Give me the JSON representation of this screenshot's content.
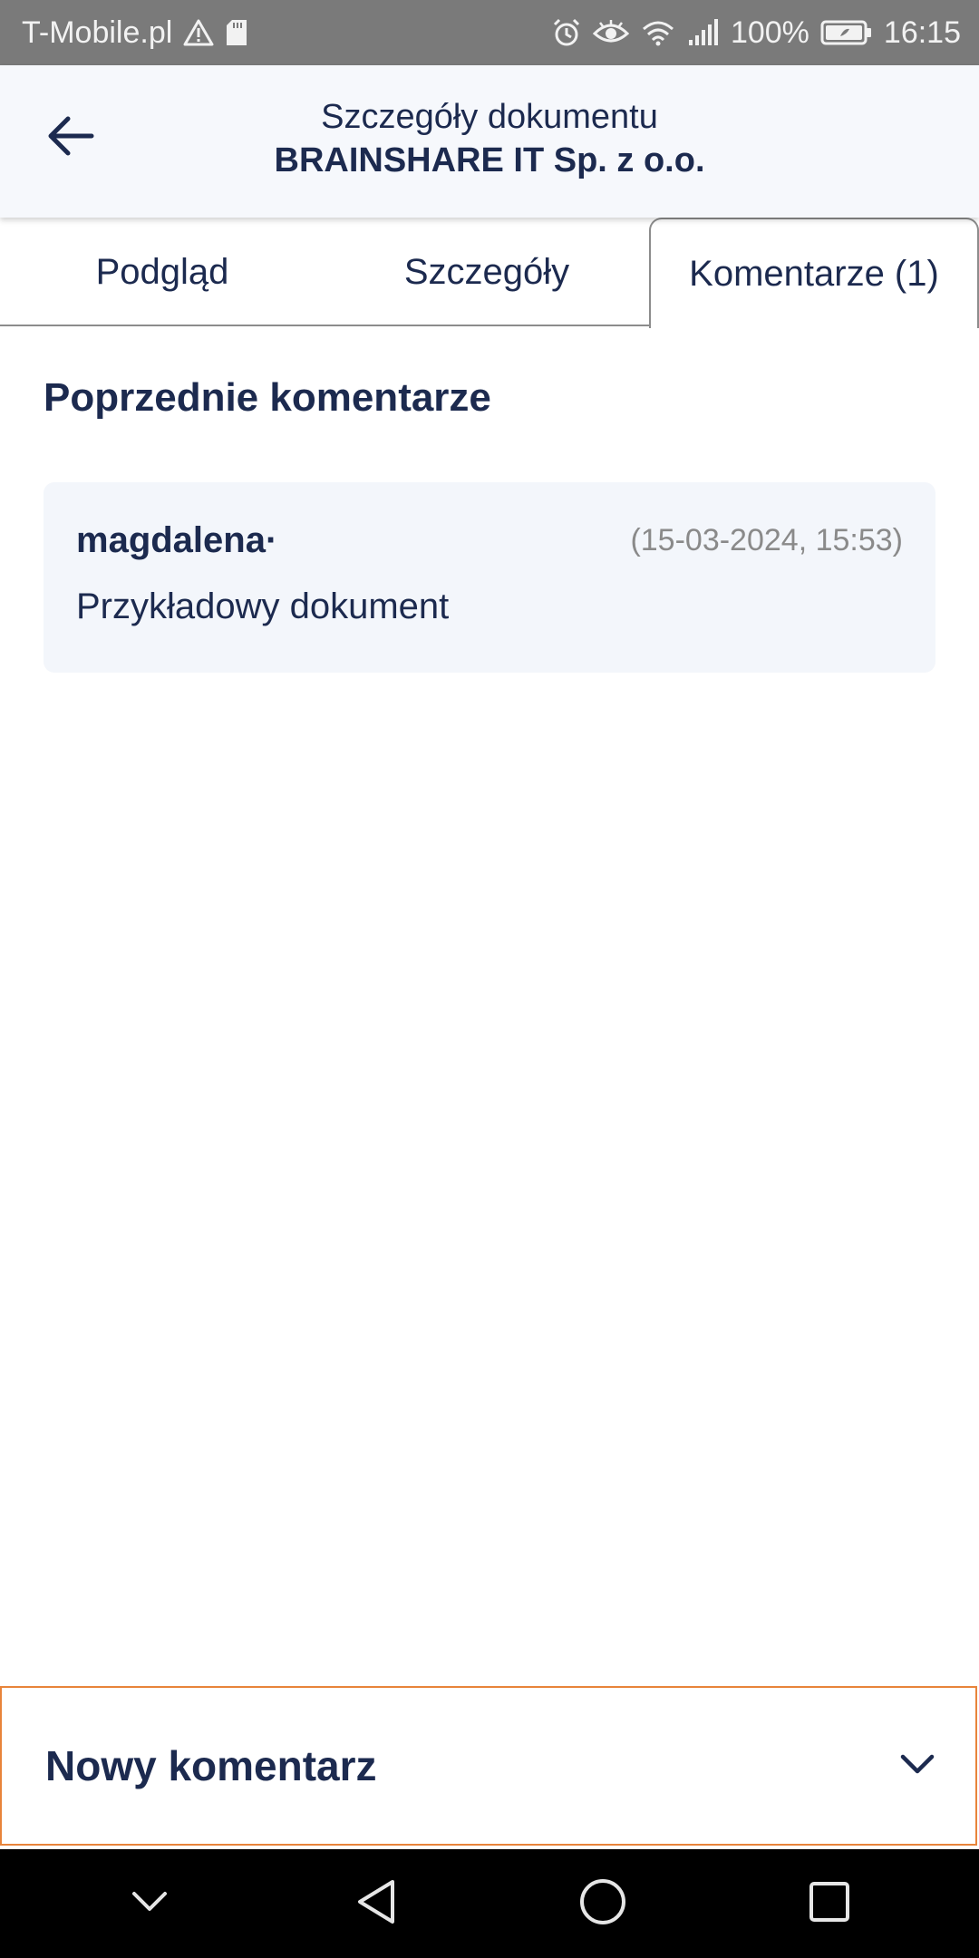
{
  "status_bar": {
    "carrier": "T-Mobile.pl",
    "battery": "100%",
    "time": "16:15",
    "icons": [
      "warning-icon",
      "sd-card-icon",
      "alarm-icon",
      "eye-icon",
      "wifi-icon",
      "signal-icon",
      "battery-icon"
    ]
  },
  "header": {
    "title": "Szczegóły dokumentu",
    "subtitle": "BRAINSHARE IT Sp. z o.o.",
    "back_icon": "arrow-left-icon"
  },
  "tabs": [
    {
      "label": "Podgląd",
      "active": false
    },
    {
      "label": "Szczegóły",
      "active": false
    },
    {
      "label": "Komentarze (1)",
      "active": true
    }
  ],
  "comments": {
    "section_title": "Poprzednie komentarze",
    "items": [
      {
        "author": "magdalena·",
        "date": "(15-03-2024, 15:53)",
        "text": "Przykładowy dokument"
      }
    ]
  },
  "new_comment": {
    "label": "Nowy komentarz",
    "icon": "chevron-down-icon",
    "border_color": "#e8843a"
  },
  "colors": {
    "text": "#1c2a4f",
    "header_bg": "#f6f8fc",
    "card_bg": "#f3f6fb",
    "status_bar_bg": "#7a7a7a"
  }
}
